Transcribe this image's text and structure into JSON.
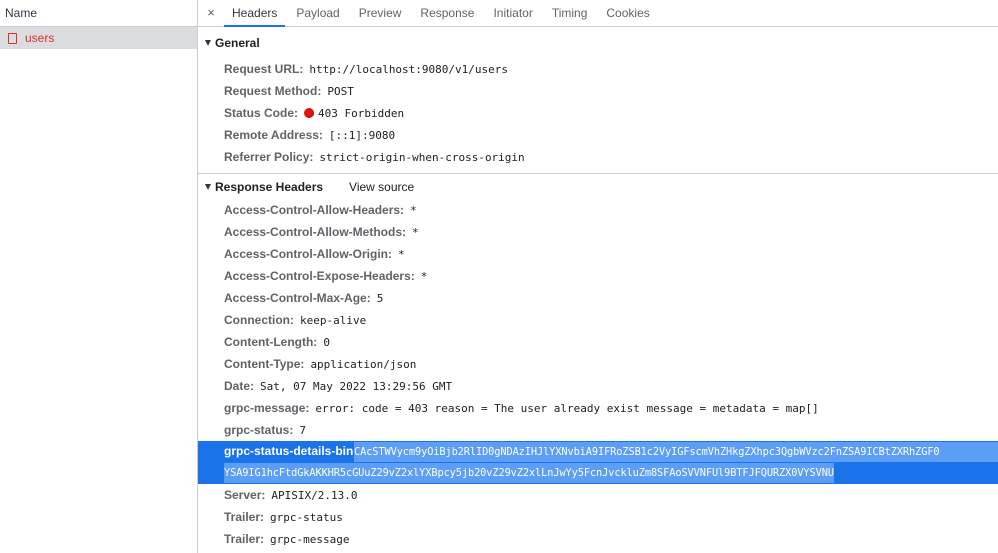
{
  "requests": {
    "column_header": "Name",
    "items": [
      {
        "name": "users"
      }
    ]
  },
  "tabs": {
    "close_label": "×",
    "items": [
      "Headers",
      "Payload",
      "Preview",
      "Response",
      "Initiator",
      "Timing",
      "Cookies"
    ],
    "active": "Headers"
  },
  "general": {
    "title": "General",
    "request_url_key": "Request URL:",
    "request_url": "http://localhost:9080/v1/users",
    "request_method_key": "Request Method:",
    "request_method": "POST",
    "status_code_key": "Status Code:",
    "status_code": "403 Forbidden",
    "remote_address_key": "Remote Address:",
    "remote_address": "[::1]:9080",
    "referrer_policy_key": "Referrer Policy:",
    "referrer_policy": "strict-origin-when-cross-origin"
  },
  "response_headers": {
    "title": "Response Headers",
    "view_source": "View source",
    "h0_key": "Access-Control-Allow-Headers:",
    "h0_val": "*",
    "h1_key": "Access-Control-Allow-Methods:",
    "h1_val": "*",
    "h2_key": "Access-Control-Allow-Origin:",
    "h2_val": "*",
    "h3_key": "Access-Control-Expose-Headers:",
    "h3_val": "*",
    "h4_key": "Access-Control-Max-Age:",
    "h4_val": "5",
    "h5_key": "Connection:",
    "h5_val": "keep-alive",
    "h6_key": "Content-Length:",
    "h6_val": "0",
    "h7_key": "Content-Type:",
    "h7_val": "application/json",
    "h8_key": "Date:",
    "h8_val": "Sat, 07 May 2022 13:29:56 GMT",
    "h9_key": "grpc-message:",
    "h9_val": "error: code = 403 reason = The user already exist message =  metadata = map[]",
    "h10_key": "grpc-status:",
    "h10_val": "7",
    "bin_key": "grpc-status-details-bin:",
    "bin_val_line1": "CAcSTWVycm9yOiBjb2RlID0gNDAzIHJlYXNvbiA9IFRoZSB1c2VyIGFscmVhZHkgZXhpc3QgbWVzc2FnZSA9ICBtZXRhZGF0",
    "bin_val_line2": "YSA9IG1hcFtdGkAKKHR5cGUuZ29vZ2xlYXBpcy5jb20vZ29vZ2xlLnJwYy5FcnJvckluZm8SFAoSVVNFUl9BTFJFQURZX0VYSVNU",
    "h11_key": "Server:",
    "h11_val": "APISIX/2.13.0",
    "h12_key": "Trailer:",
    "h12_val": "grpc-status",
    "h13_key": "Trailer:",
    "h13_val": "grpc-message"
  },
  "colors": {
    "accent": "#1a73e8",
    "error": "#d93025",
    "status_dot": "#e8120c"
  }
}
